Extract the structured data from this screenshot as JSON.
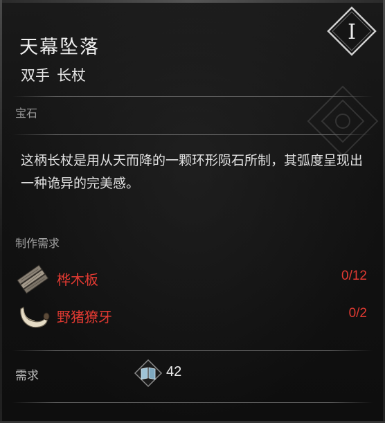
{
  "item": {
    "name": "天幕坠落",
    "weapon_class": "双手",
    "weapon_type": "长杖",
    "tier": "I",
    "category": "宝石",
    "description": "这柄长杖是用从天而降的一颗环形陨石所制，其弧度呈现出一种诡异的完美感。"
  },
  "crafting": {
    "label": "制作需求",
    "materials": [
      {
        "name": "桦木板",
        "count": "0/12",
        "icon": "wood-planks-icon"
      },
      {
        "name": "野猪獠牙",
        "count": "0/2",
        "icon": "boar-tusk-icon"
      }
    ]
  },
  "requirement": {
    "label": "需求",
    "icon": "book-icon",
    "value": "42"
  },
  "colors": {
    "missing_material": "#e23a32",
    "title": "#f0f0f0",
    "muted_label": "#9a9a9a"
  }
}
